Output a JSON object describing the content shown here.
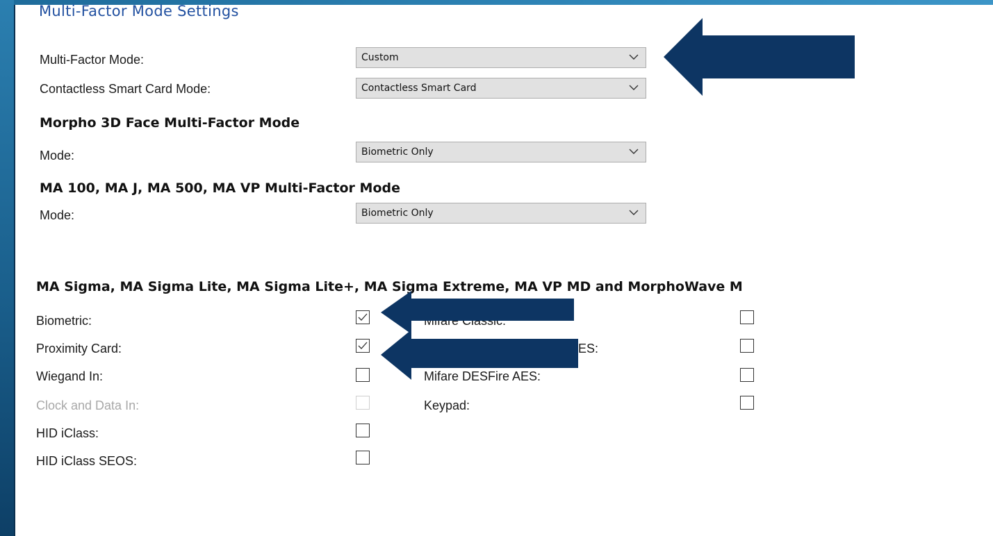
{
  "title": "Multi-Factor Mode Settings",
  "fields": {
    "multi_factor_mode": {
      "label": "Multi-Factor Mode:",
      "value": "Custom"
    },
    "contactless_mode": {
      "label": "Contactless Smart Card Mode:",
      "value": "Contactless Smart Card"
    }
  },
  "morpho3d": {
    "heading": "Morpho 3D Face Multi-Factor Mode",
    "mode_label": "Mode:",
    "mode_value": "Biometric Only"
  },
  "ma100": {
    "heading": "MA 100, MA J, MA 500, MA VP Multi-Factor Mode",
    "mode_label": "Mode:",
    "mode_value": "Biometric Only"
  },
  "sigma": {
    "heading": "MA Sigma, MA Sigma Lite, MA Sigma Lite+, MA Sigma Extreme, MA VP MD and MorphoWave M",
    "left_items": [
      {
        "label": "Biometric:",
        "checked": true,
        "enabled": true
      },
      {
        "label": "Proximity Card:",
        "checked": true,
        "enabled": true
      },
      {
        "label": "Wiegand In:",
        "checked": false,
        "enabled": true
      },
      {
        "label": "Clock and Data In:",
        "checked": false,
        "enabled": false
      },
      {
        "label": "HID iClass:",
        "checked": false,
        "enabled": true
      },
      {
        "label": "HID iClass SEOS:",
        "checked": false,
        "enabled": true
      }
    ],
    "right_items": [
      {
        "label": "Mifare Classic:",
        "checked": false
      },
      {
        "label": "ES:",
        "checked": false
      },
      {
        "label": "Mifare DESFire AES:",
        "checked": false
      },
      {
        "label": "Keypad:",
        "checked": false
      }
    ]
  },
  "colors": {
    "arrow": "#0d3563",
    "title": "#2150a0",
    "frame": "#1a5f8c"
  },
  "icons": {
    "dropdown": "chevron-down-icon",
    "check": "checkmark-icon",
    "pointer": "arrow-left-icon"
  }
}
